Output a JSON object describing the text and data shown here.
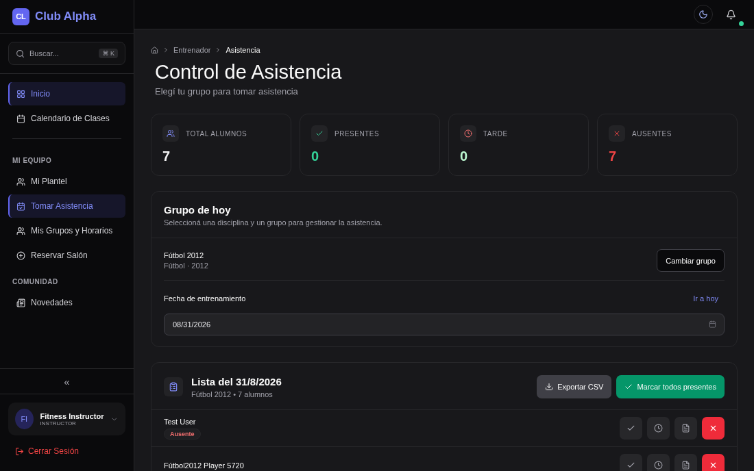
{
  "brand": {
    "initials": "CL",
    "name": "Club Alpha"
  },
  "search": {
    "placeholder": "Buscar...",
    "shortcut": "⌘ K"
  },
  "sidebar": {
    "main_items": [
      {
        "label": "Inicio",
        "selected": true
      },
      {
        "label": "Calendario de Clases",
        "selected": false
      }
    ],
    "sections": [
      {
        "title": "MI EQUIPO",
        "items": [
          {
            "label": "Mi Plantel",
            "selected": false
          },
          {
            "label": "Tomar Asistencia",
            "selected": true
          },
          {
            "label": "Mis Grupos y Horarios",
            "selected": false
          },
          {
            "label": "Reservar Salón",
            "selected": false
          }
        ]
      },
      {
        "title": "COMUNIDAD",
        "items": [
          {
            "label": "Novedades",
            "selected": false
          }
        ]
      }
    ],
    "collapse": "«",
    "user": {
      "initials": "FI",
      "name": "Fitness Instructor",
      "role": "INSTRUCTOR"
    },
    "logout": "Cerrar Sesión"
  },
  "topbar": {
    "notification_dot": true
  },
  "breadcrumb": [
    "Entrenador",
    "Asistencia"
  ],
  "page": {
    "title": "Control de Asistencia",
    "subtitle": "Elegí tu grupo para tomar asistencia"
  },
  "stats": [
    {
      "label": "TOTAL ALUMNOS",
      "value": "7",
      "color": "#f4f4f5"
    },
    {
      "label": "PRESENTES",
      "value": "0",
      "color": "#34d399"
    },
    {
      "label": "TARDE",
      "value": "0",
      "color": "#bbf7d0"
    },
    {
      "label": "AUSENTES",
      "value": "7",
      "color": "#ef4444"
    }
  ],
  "group_card": {
    "title": "Grupo de hoy",
    "subtitle": "Seleccioná una disciplina y un grupo para gestionar la asistencia.",
    "group_name": "Fútbol 2012",
    "group_detail": "Fútbol · 2012",
    "change_button": "Cambiar grupo",
    "date_label": "Fecha de entrenamiento",
    "today_link": "Ir a hoy",
    "date_value": "08/31/2026"
  },
  "list": {
    "title": "Lista del 31/8/2026",
    "subtitle": "Fútbol 2012 • 7 alumnos",
    "export_button": "Exportar CSV",
    "mark_all_button": "Marcar todos presentes",
    "students": [
      {
        "name": "Test User",
        "badge": "Ausente",
        "actions": [
          {
            "kind": "present",
            "selected": false
          },
          {
            "kind": "late",
            "selected": false
          },
          {
            "kind": "justified",
            "selected": false
          },
          {
            "kind": "absent",
            "selected": true
          }
        ]
      },
      {
        "name": "Fútbol2012 Player 5720",
        "actions": [
          {
            "kind": "present",
            "selected": false
          },
          {
            "kind": "late",
            "selected": false
          },
          {
            "kind": "justified",
            "selected": false
          },
          {
            "kind": "absent",
            "selected": true
          }
        ]
      }
    ]
  }
}
